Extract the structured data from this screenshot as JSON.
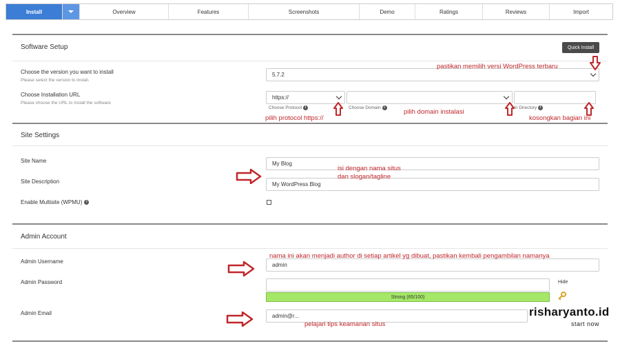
{
  "tabs": {
    "install": "Install",
    "overview": "Overview",
    "features": "Features",
    "screenshots": "Screenshots",
    "demo": "Demo",
    "ratings": "Ratings",
    "reviews": "Reviews",
    "import": "Import"
  },
  "software_setup": {
    "title": "Software Setup",
    "quick_install": "Quick Install",
    "version_label": "Choose the version you want to install",
    "version_sub": "Please select the version to install.",
    "version_value": "5.7.2",
    "url_label": "Choose Installation URL",
    "url_sub": "Please choose the URL to install the software",
    "protocol_value": "https://",
    "protocol_hint": "Choose Protocol",
    "domain_hint": "Choose Domain",
    "directory_hint": "In Directory"
  },
  "site_settings": {
    "title": "Site Settings",
    "name_label": "Site Name",
    "name_value": "My Blog",
    "desc_label": "Site Description",
    "desc_value": "My WordPress Blog",
    "multisite_label": "Enable Multisite (WPMU)"
  },
  "admin_account": {
    "title": "Admin Account",
    "username_label": "Admin Username",
    "username_value": "admin",
    "password_label": "Admin Password",
    "hide_label": "Hide",
    "strength": "Strong (65/100)",
    "strength_percent": 65,
    "email_label": "Admin Email",
    "email_value": "admin@r..."
  },
  "annotations": {
    "version": "pastikan memilih versi WordPress terbaru",
    "protocol": "pilih protocol https://",
    "domain": "pilih domain instalasi",
    "directory": "kosongkan bagian ini",
    "site_1": "isi dengan nama situs",
    "site_2": "dan slogan/tagline",
    "author": "nama ini akan menjadi author di setiap artikel yg dibuat, pastikan kembali pengambilan namanya",
    "security": "pelajari tips keamanan situs",
    "color": "#c0262a"
  },
  "brand": {
    "name": "risharyanto.id",
    "tagline": "start now"
  }
}
